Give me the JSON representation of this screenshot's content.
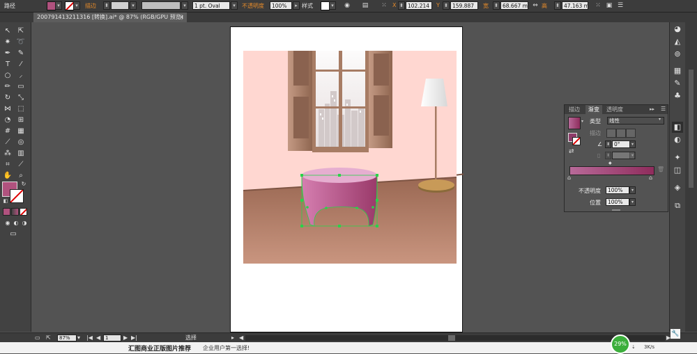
{
  "control_bar": {
    "selection_type": "路径",
    "stroke_label": "描边",
    "brush_value": "1 pt. Oval",
    "opacity_label": "不透明度",
    "opacity_value": "100%",
    "style_label": "样式",
    "x_label": "X",
    "x_value": "102.214",
    "y_label": "Y",
    "y_value": "159.887",
    "w_label": "宽",
    "w_value": "68.667 mm",
    "h_label": "高",
    "h_value": "47.163 mm"
  },
  "document_tab": {
    "title": "200791413211316 [转换].ai* @ 87% (RGB/GPU 预览)",
    "close": "×"
  },
  "gradient_panel": {
    "tabs": [
      "描边",
      "渐变",
      "透明度"
    ],
    "active_tab": "渐变",
    "type_label": "类型",
    "type_value": "线性",
    "stroke_label": "描边",
    "angle_value": "0°",
    "opacity_label": "不透明度",
    "opacity_value": "100%",
    "location_label": "位置",
    "location_value": "100%",
    "gradient_start": "#b86a99",
    "gradient_end": "#8f2c5c"
  },
  "status_bar": {
    "zoom": "87%",
    "page": "1",
    "tool_status": "选择"
  },
  "ad_strip": {
    "headline": "汇图商业正版图片推荐",
    "tagline": "企业用户第一选择!",
    "net_percent": "29%",
    "net_speed": "3K/s"
  },
  "colors": {
    "fill": "#b0527e",
    "wall": "#ffd7d1",
    "floor_top": "#9c6a55",
    "floor_bottom": "#c5917c",
    "frame": "#a77c64",
    "shutter": "#a87e68",
    "table_top": "#e6aed0",
    "selection": "#2bd24a",
    "orange_label": "#e48a2a"
  }
}
